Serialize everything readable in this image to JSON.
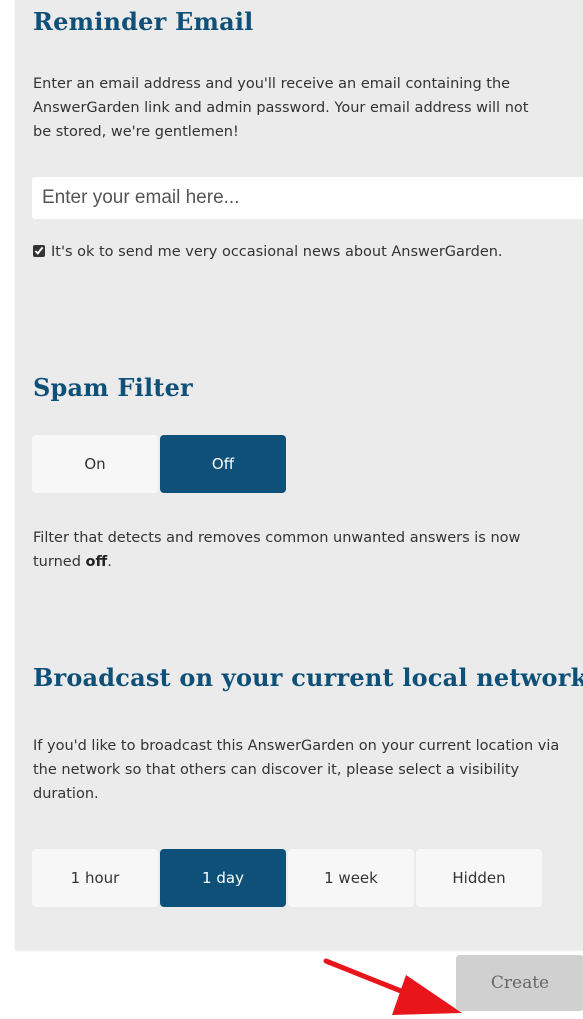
{
  "reminder": {
    "heading": "Reminder Email",
    "description": "Enter an email address and you'll receive an email containing the AnswerGarden link and admin password. Your email address will not be stored, we're gentlemen!",
    "email_placeholder": "Enter your email here...",
    "email_value": "",
    "newsletter_checked": true,
    "newsletter_label": "It's ok to send me very occasional news about AnswerGarden."
  },
  "spam": {
    "heading": "Spam Filter",
    "options": [
      "On",
      "Off"
    ],
    "selected": "Off",
    "desc_prefix": "Filter that detects and removes common unwanted answers is now turned ",
    "desc_state": "off",
    "desc_suffix": "."
  },
  "broadcast": {
    "heading": "Broadcast on your current local network",
    "description": "If you'd like to broadcast this AnswerGarden on your current location via the network so that others can discover it, please select a visibility duration.",
    "options": [
      "1 hour",
      "1 day",
      "1 week",
      "Hidden"
    ],
    "selected": "1 day"
  },
  "footer": {
    "create_label": "Create"
  },
  "colors": {
    "accent": "#0f5079",
    "panel_bg": "#ebebeb",
    "arrow": "#e8161b"
  }
}
